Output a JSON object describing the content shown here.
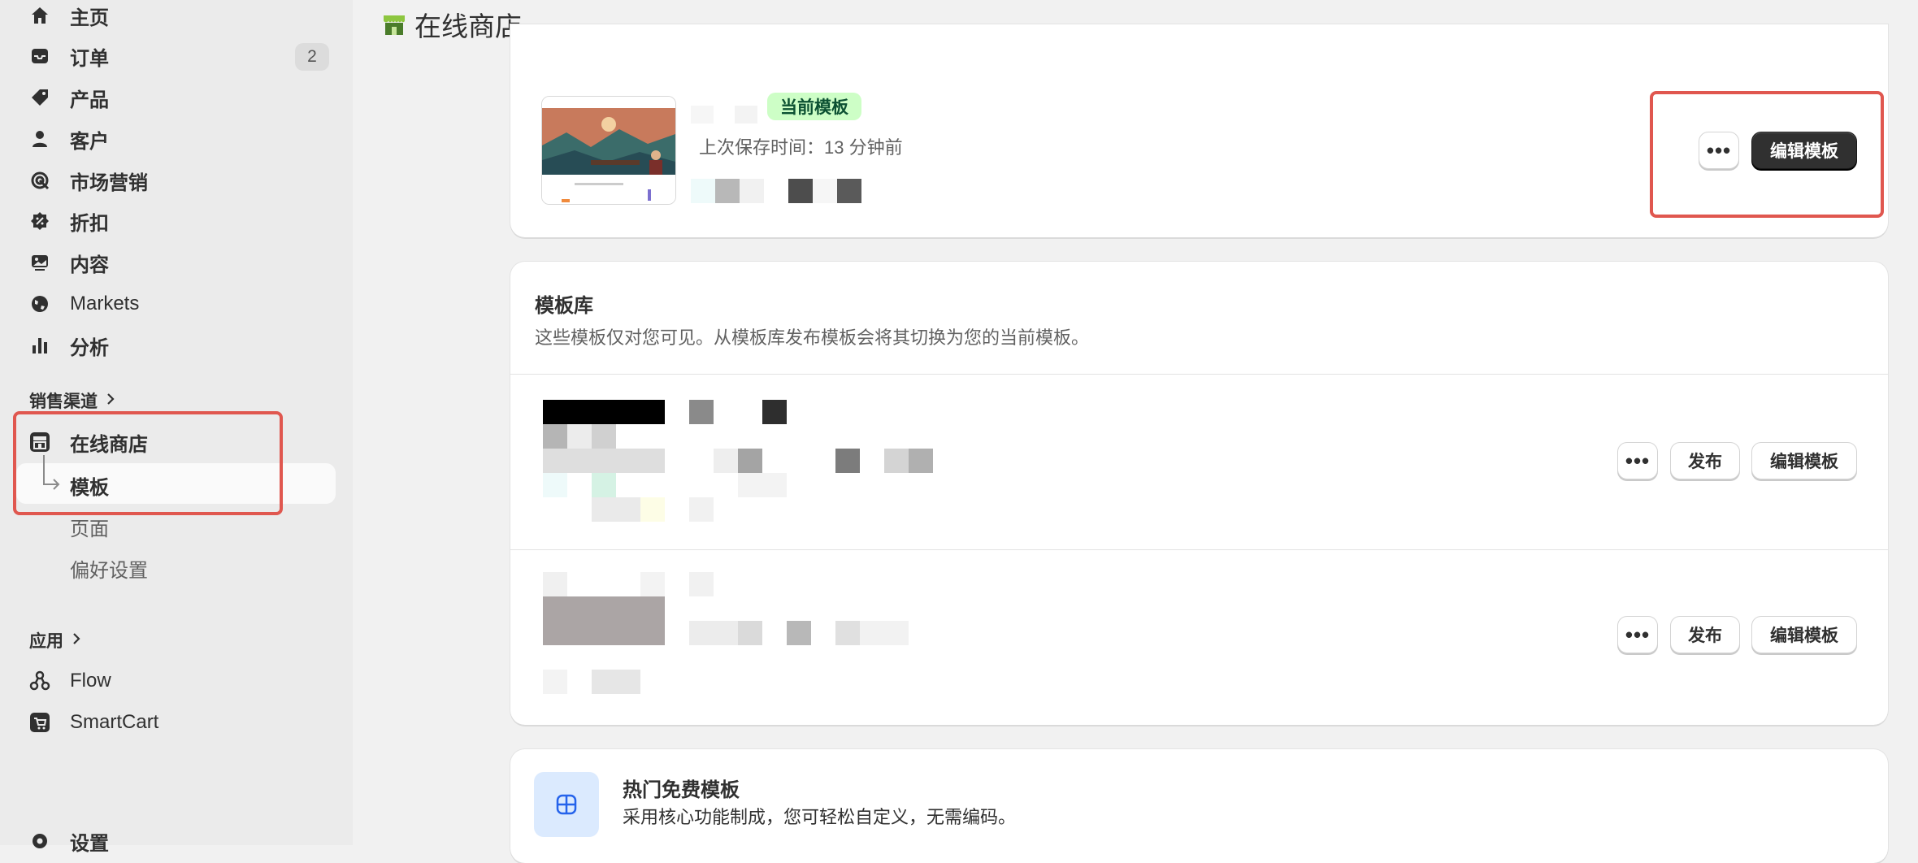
{
  "sidebar": {
    "items": [
      {
        "label": "主页",
        "icon": "home-icon"
      },
      {
        "label": "订单",
        "icon": "inbox-icon",
        "badge": "2"
      },
      {
        "label": "产品",
        "icon": "tag-icon"
      },
      {
        "label": "客户",
        "icon": "person-icon"
      },
      {
        "label": "市场营销",
        "icon": "target-icon"
      },
      {
        "label": "折扣",
        "icon": "discount-icon"
      },
      {
        "label": "内容",
        "icon": "image-icon"
      },
      {
        "label": "Markets",
        "icon": "globe-icon"
      },
      {
        "label": "分析",
        "icon": "bar-chart-icon"
      }
    ],
    "sales_channels": {
      "title": "销售渠道",
      "online_store": "在线商店",
      "sub_items": [
        "模板",
        "页面",
        "偏好设置"
      ]
    },
    "apps": {
      "title": "应用",
      "items": [
        "Flow",
        "SmartCart"
      ]
    },
    "settings": "设置"
  },
  "header": {
    "title": "在线商店"
  },
  "current_theme": {
    "badge": "当前模板",
    "saved": "上次保存时间：13 分钟前",
    "more_label": "•••",
    "edit_label": "编辑模板"
  },
  "library": {
    "title": "模板库",
    "description": "这些模板仅对您可见。从模板库发布模板会将其切换为您的当前模板。",
    "rows": [
      {
        "more_label": "•••",
        "publish_label": "发布",
        "edit_label": "编辑模板"
      },
      {
        "more_label": "•••",
        "publish_label": "发布",
        "edit_label": "编辑模板"
      }
    ]
  },
  "popular": {
    "title": "热门免费模板",
    "description": "采用核心功能制成，您可轻松自定义，无需编码。"
  },
  "colors": {
    "accent_dark": "#303030",
    "badge_green_bg": "#cdfec6",
    "badge_green_text": "#0c5132",
    "highlight_red": "#e0574f",
    "store_icon_green": "#8dc63f"
  }
}
